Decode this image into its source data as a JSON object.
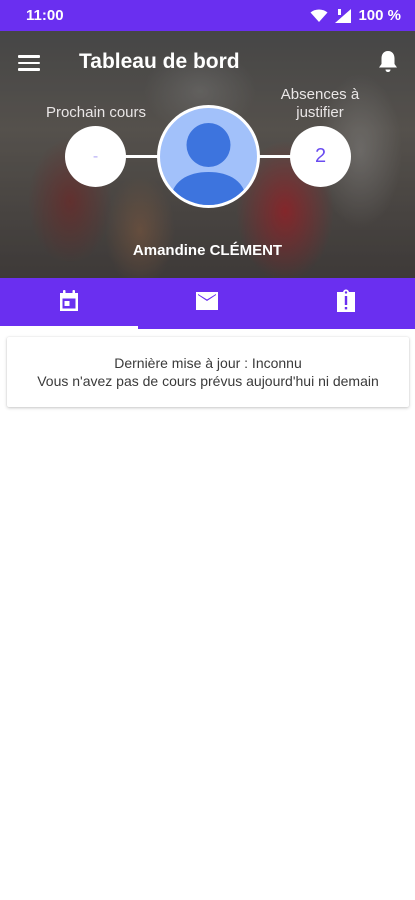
{
  "status_bar": {
    "time": "11:00",
    "battery": "100 %",
    "icons": [
      "wifi-icon",
      "signal-icon"
    ]
  },
  "header": {
    "title": "Tableau de bord",
    "menu_icon": "menu-icon",
    "notification_icon": "bell-icon",
    "next_class": {
      "label": "Prochain cours",
      "value": "-"
    },
    "absences": {
      "label_line1": "Absences à",
      "label_line2": "justifier",
      "value": "2"
    },
    "user_name": "Amandine CLÉMENT",
    "avatar_icon": "person-avatar-icon"
  },
  "tabs": [
    {
      "icon": "calendar-icon",
      "active": true
    },
    {
      "icon": "mail-icon",
      "active": false
    },
    {
      "icon": "clipboard-alert-icon",
      "active": false
    }
  ],
  "card": {
    "line1": "Dernière mise à jour : Inconnu",
    "line2": "Vous n'avez pas de cours prévus aujourd'hui ni demain"
  },
  "colors": {
    "primary": "#6a2ff0",
    "avatar_bg": "#a2c1fa",
    "avatar_fg": "#3d74de"
  }
}
